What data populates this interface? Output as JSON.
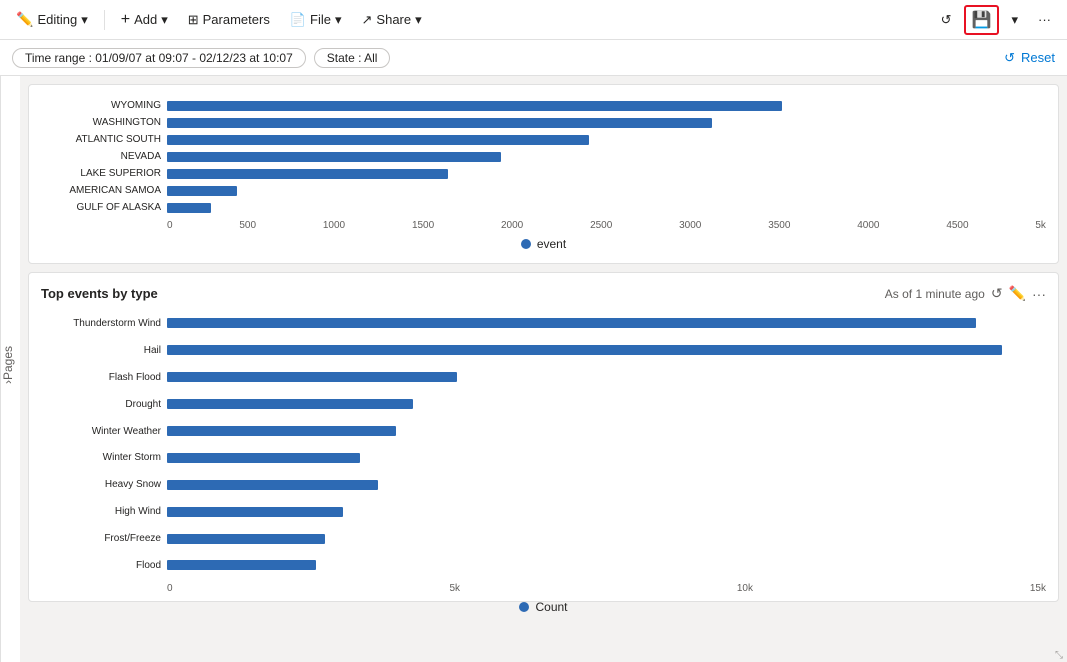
{
  "toolbar": {
    "editing_label": "Editing",
    "add_label": "Add",
    "parameters_label": "Parameters",
    "file_label": "File",
    "share_label": "Share",
    "refresh_title": "Refresh",
    "save_title": "Save",
    "chevron_down": "⌄",
    "more_options": "···"
  },
  "filter_bar": {
    "time_range_label": "Time range : 01/09/07 at 09:07 - 02/12/23 at 10:07",
    "state_label": "State : All",
    "reset_label": "Reset"
  },
  "pages_sidebar": {
    "label": "Pages",
    "arrow": "›"
  },
  "top_chart": {
    "rows": [
      {
        "label": "WYOMING",
        "value": 70,
        "max": 100
      },
      {
        "label": "WASHINGTON",
        "value": 62,
        "max": 100
      },
      {
        "label": "ATLANTIC SOUTH",
        "value": 48,
        "max": 100
      },
      {
        "label": "NEVADA",
        "value": 38,
        "max": 100
      },
      {
        "label": "LAKE SUPERIOR",
        "value": 32,
        "max": 100
      },
      {
        "label": "AMERICAN SAMOA",
        "value": 8,
        "max": 100
      },
      {
        "label": "GULF OF ALASKA",
        "value": 5,
        "max": 100
      }
    ],
    "x_axis": [
      "0",
      "500",
      "1000",
      "1500",
      "2000",
      "2500",
      "3000",
      "3500",
      "4000",
      "4500",
      "5k"
    ],
    "legend_label": "event"
  },
  "bottom_chart": {
    "title": "Top events by type",
    "meta": "As of 1 minute ago",
    "rows": [
      {
        "label": "Thunderstorm Wind",
        "value": 92,
        "display": ""
      },
      {
        "label": "Hail",
        "value": 95,
        "display": ""
      },
      {
        "label": "Flash Flood",
        "value": 33,
        "display": ""
      },
      {
        "label": "Drought",
        "value": 28,
        "display": ""
      },
      {
        "label": "Winter Weather",
        "value": 26,
        "display": ""
      },
      {
        "label": "Winter Storm",
        "value": 22,
        "display": ""
      },
      {
        "label": "Heavy Snow",
        "value": 24,
        "display": ""
      },
      {
        "label": "High Wind",
        "value": 20,
        "display": ""
      },
      {
        "label": "Frost/Freeze",
        "value": 18,
        "display": ""
      },
      {
        "label": "Flood",
        "value": 17,
        "display": ""
      }
    ],
    "x_axis": [
      "0",
      "5k",
      "10k",
      "15k"
    ],
    "legend_label": "Count"
  }
}
